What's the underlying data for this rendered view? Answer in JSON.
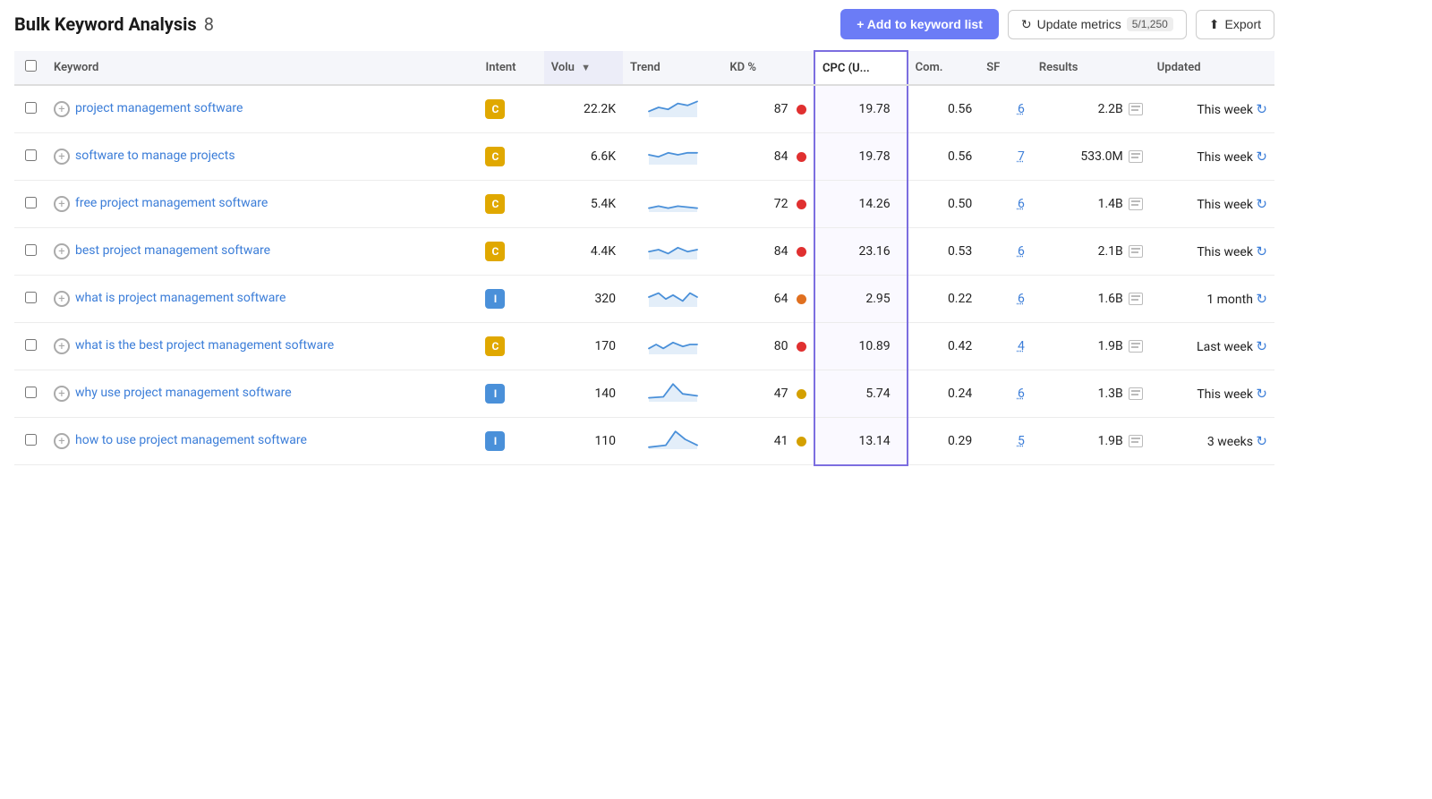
{
  "header": {
    "title": "Bulk Keyword Analysis",
    "count": "8",
    "add_button": "+ Add to keyword list",
    "update_button": "Update metrics",
    "update_badge": "5/1,250",
    "export_button": "Export"
  },
  "table": {
    "columns": [
      {
        "id": "checkbox",
        "label": ""
      },
      {
        "id": "keyword",
        "label": "Keyword"
      },
      {
        "id": "intent",
        "label": "Intent"
      },
      {
        "id": "volume",
        "label": "Volu",
        "sorted": true
      },
      {
        "id": "trend",
        "label": "Trend"
      },
      {
        "id": "kd",
        "label": "KD %"
      },
      {
        "id": "cpc",
        "label": "CPC (U...",
        "highlighted": true
      },
      {
        "id": "com",
        "label": "Com."
      },
      {
        "id": "sf",
        "label": "SF"
      },
      {
        "id": "results",
        "label": "Results"
      },
      {
        "id": "updated",
        "label": "Updated"
      }
    ],
    "rows": [
      {
        "keyword": "project management software",
        "intent": "C",
        "volume": "22.2K",
        "kd": 87,
        "kd_color": "red",
        "cpc": "19.78",
        "com": "0.56",
        "sf": "6",
        "results": "2.2B",
        "updated": "This week",
        "trend": "stable-up"
      },
      {
        "keyword": "software to manage projects",
        "intent": "C",
        "volume": "6.6K",
        "kd": 84,
        "kd_color": "red",
        "cpc": "19.78",
        "com": "0.56",
        "sf": "7",
        "results": "533.0M",
        "updated": "This week",
        "trend": "stable"
      },
      {
        "keyword": "free project management software",
        "intent": "C",
        "volume": "5.4K",
        "kd": 72,
        "kd_color": "red",
        "cpc": "14.26",
        "com": "0.50",
        "sf": "6",
        "results": "1.4B",
        "updated": "This week",
        "trend": "flat"
      },
      {
        "keyword": "best project management software",
        "intent": "C",
        "volume": "4.4K",
        "kd": 84,
        "kd_color": "red",
        "cpc": "23.16",
        "com": "0.53",
        "sf": "6",
        "results": "2.1B",
        "updated": "This week",
        "trend": "flat-wave"
      },
      {
        "keyword": "what is project management software",
        "intent": "I",
        "volume": "320",
        "kd": 64,
        "kd_color": "orange",
        "cpc": "2.95",
        "com": "0.22",
        "sf": "6",
        "results": "1.6B",
        "updated": "1 month",
        "trend": "wave"
      },
      {
        "keyword": "what is the best project management software",
        "intent": "C",
        "volume": "170",
        "kd": 80,
        "kd_color": "red",
        "cpc": "10.89",
        "com": "0.42",
        "sf": "4",
        "results": "1.9B",
        "updated": "Last week",
        "trend": "stable-wave"
      },
      {
        "keyword": "why use project management software",
        "intent": "I",
        "volume": "140",
        "kd": 47,
        "kd_color": "yellow",
        "cpc": "5.74",
        "com": "0.24",
        "sf": "6",
        "results": "1.3B",
        "updated": "This week",
        "trend": "spike"
      },
      {
        "keyword": "how to use project management software",
        "intent": "I",
        "volume": "110",
        "kd": 41,
        "kd_color": "yellow",
        "cpc": "13.14",
        "com": "0.29",
        "sf": "5",
        "results": "1.9B",
        "updated": "3 weeks",
        "trend": "spike2"
      }
    ]
  }
}
